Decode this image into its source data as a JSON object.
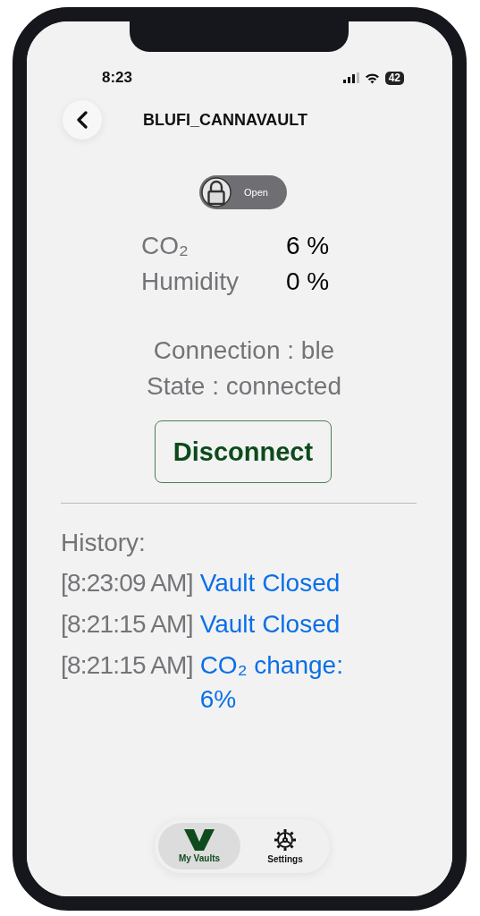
{
  "status_bar": {
    "time": "8:23",
    "battery": "42"
  },
  "header": {
    "title": "BLUFI_CANNAVAULT"
  },
  "lock_toggle": {
    "label": "Open",
    "on": false
  },
  "readings": [
    {
      "label": "CO₂",
      "value": "6 %"
    },
    {
      "label": "Humidity",
      "value": "0 %"
    }
  ],
  "connection": {
    "connection": "Connection : ble",
    "state": "State : connected"
  },
  "disconnect_button": "Disconnect",
  "history": {
    "title": "History:",
    "entries": [
      {
        "time": "[8:23:09 AM]",
        "event": "Vault Closed"
      },
      {
        "time": "[8:21:15 AM]",
        "event": "Vault Closed"
      },
      {
        "time": "[8:21:15 AM]",
        "event": "CO₂ change: 6%"
      }
    ]
  },
  "tab_bar": [
    {
      "label": "My Vaults",
      "kind": "vault",
      "selected": true
    },
    {
      "label": "Settings",
      "kind": "settings",
      "selected": false
    }
  ]
}
